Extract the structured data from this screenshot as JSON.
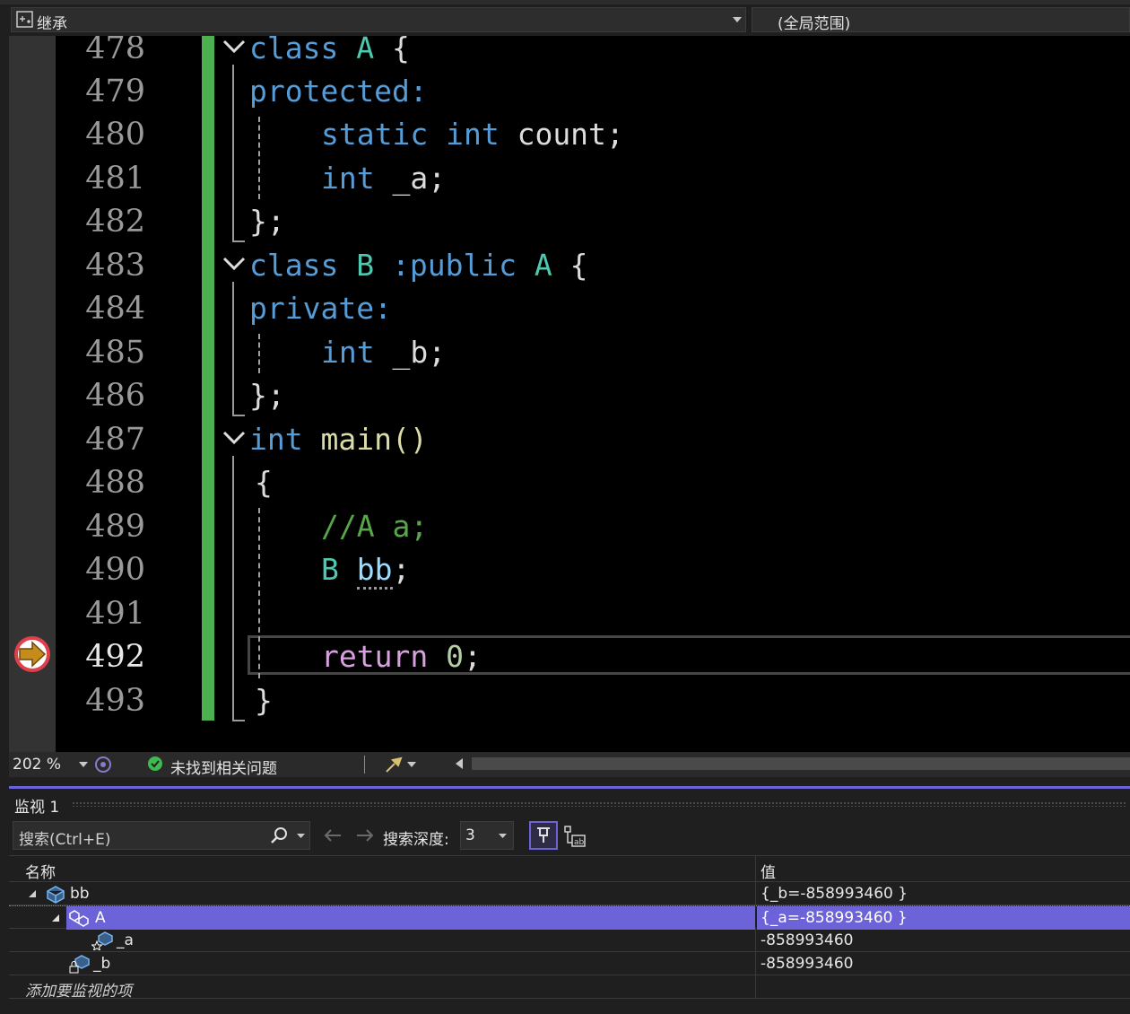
{
  "nav": {
    "scope_left": "继承",
    "scope_right": "(全局范围)"
  },
  "editor": {
    "lines": [
      {
        "n": "478"
      },
      {
        "n": "479"
      },
      {
        "n": "480"
      },
      {
        "n": "481"
      },
      {
        "n": "482"
      },
      {
        "n": "483"
      },
      {
        "n": "484"
      },
      {
        "n": "485"
      },
      {
        "n": "486"
      },
      {
        "n": "487"
      },
      {
        "n": "488"
      },
      {
        "n": "489"
      },
      {
        "n": "490"
      },
      {
        "n": "491"
      },
      {
        "n": "492"
      },
      {
        "n": "493"
      }
    ],
    "code": {
      "l478a": "class",
      "l478b": "A",
      "l478c": "{",
      "l479": "protected:",
      "l480a": "static",
      "l480b": "int",
      "l480c": "count;",
      "l481a": "int",
      "l481b": "_a;",
      "l482": "};",
      "l483a": "class",
      "l483b": "B",
      "l483c": ":public",
      "l483d": "A",
      "l483e": "{",
      "l484": "private:",
      "l485a": "int",
      "l485b": "_b;",
      "l486": "};",
      "l487a": "int",
      "l487b": "main()",
      "l488": "{",
      "l489": "//A a;",
      "l490a": "B",
      "l490b": "bb",
      "l490c": ";",
      "l492a": "return",
      "l492b": "0",
      "l492c": ";",
      "l493": "}"
    },
    "current_line": "492"
  },
  "status": {
    "zoom": "202 %",
    "issues": "未找到相关问题"
  },
  "watch": {
    "title": "监视 1",
    "search_placeholder": "搜索(Ctrl+E)",
    "depth_label": "搜索深度:",
    "depth_value": "3",
    "col_name": "名称",
    "col_value": "值",
    "rows": [
      {
        "name": "bb",
        "value": "{_b=-858993460 }"
      },
      {
        "name": "A",
        "value": "{_a=-858993460 }"
      },
      {
        "name": "_a",
        "value": "-858993460"
      },
      {
        "name": "_b",
        "value": "-858993460"
      }
    ],
    "add_item": "添加要监视的项"
  },
  "colors": {
    "selection": "#6c63d8",
    "change_bar": "#4caf50",
    "breakpoint_arrow": "#c58c1c"
  }
}
